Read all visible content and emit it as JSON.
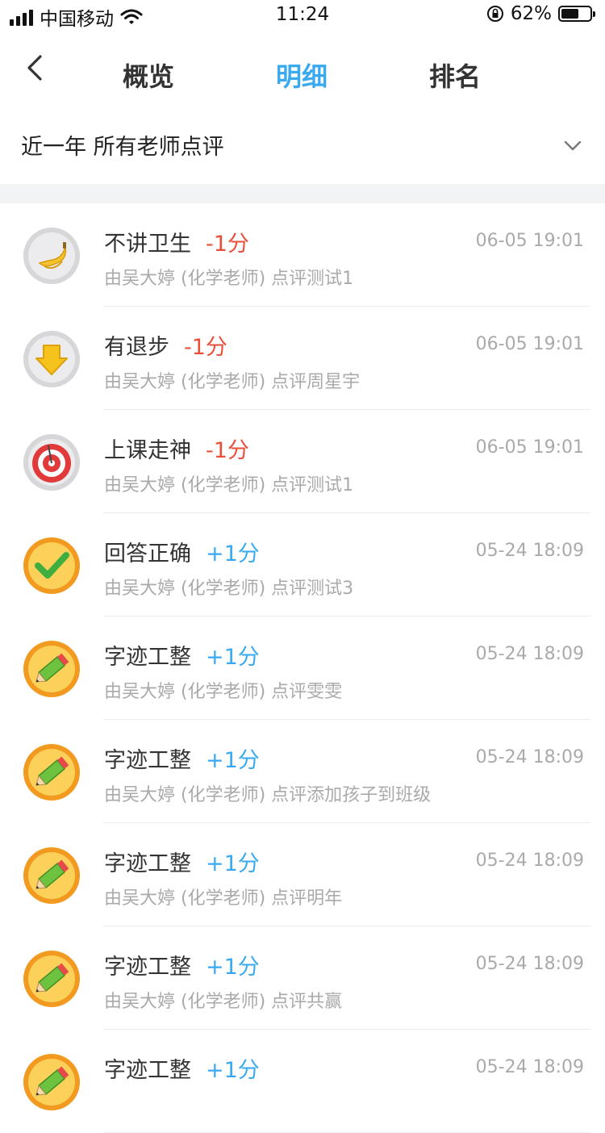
{
  "status_bar": {
    "carrier": "中国移动",
    "time": "11:24",
    "battery": "62%",
    "battery_level": 0.62
  },
  "nav": {
    "tabs": [
      {
        "label": "概览",
        "active": false
      },
      {
        "label": "明细",
        "active": true
      },
      {
        "label": "排名",
        "active": false
      }
    ]
  },
  "filter": {
    "label": "近一年 所有老师点评"
  },
  "colors": {
    "accent": "#3aaaf0",
    "negative": "#ea4f3a",
    "muted": "#aaaaaa"
  },
  "records": [
    {
      "title": "不讲卫生",
      "score": "-1分",
      "type": "neg",
      "time": "06-05 19:01",
      "sub": "由吴大婷 (化学老师) 点评测试1",
      "icon": "banana-icon"
    },
    {
      "title": "有退步",
      "score": "-1分",
      "type": "neg",
      "time": "06-05 19:01",
      "sub": "由吴大婷 (化学老师) 点评周星宇",
      "icon": "down-arrow-icon"
    },
    {
      "title": "上课走神",
      "score": "-1分",
      "type": "neg",
      "time": "06-05 19:01",
      "sub": "由吴大婷 (化学老师) 点评测试1",
      "icon": "target-icon"
    },
    {
      "title": "回答正确",
      "score": "+1分",
      "type": "pos",
      "time": "05-24 18:09",
      "sub": "由吴大婷 (化学老师) 点评测试3",
      "icon": "checkmark-icon"
    },
    {
      "title": "字迹工整",
      "score": "+1分",
      "type": "pos",
      "time": "05-24 18:09",
      "sub": "由吴大婷 (化学老师) 点评雯雯",
      "icon": "pencil-icon"
    },
    {
      "title": "字迹工整",
      "score": "+1分",
      "type": "pos",
      "time": "05-24 18:09",
      "sub": "由吴大婷 (化学老师) 点评添加孩子到班级",
      "icon": "pencil-icon"
    },
    {
      "title": "字迹工整",
      "score": "+1分",
      "type": "pos",
      "time": "05-24 18:09",
      "sub": "由吴大婷 (化学老师) 点评明年",
      "icon": "pencil-icon"
    },
    {
      "title": "字迹工整",
      "score": "+1分",
      "type": "pos",
      "time": "05-24 18:09",
      "sub": "由吴大婷 (化学老师) 点评共赢",
      "icon": "pencil-icon"
    },
    {
      "title": "字迹工整",
      "score": "+1分",
      "type": "pos",
      "time": "05-24 18:09",
      "sub": "",
      "icon": "pencil-icon"
    }
  ]
}
